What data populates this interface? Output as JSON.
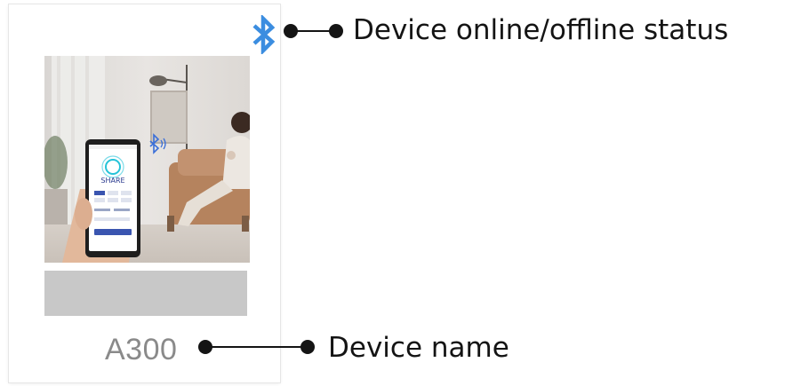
{
  "card": {
    "device_name": "A300",
    "name_placeholder": "",
    "status_icon": "bluetooth-icon",
    "status_color": "#3b8de0"
  },
  "photo": {
    "app_logo_text": "SHARE",
    "phone_icon": "bluetooth-small-icon"
  },
  "callouts": {
    "status_label": "Device online/offline status",
    "name_label": "Device name"
  },
  "colors": {
    "accent": "#3b8de0",
    "bar": "#c8c8c8",
    "name_text": "#8a8a8a",
    "callout": "#141414"
  }
}
